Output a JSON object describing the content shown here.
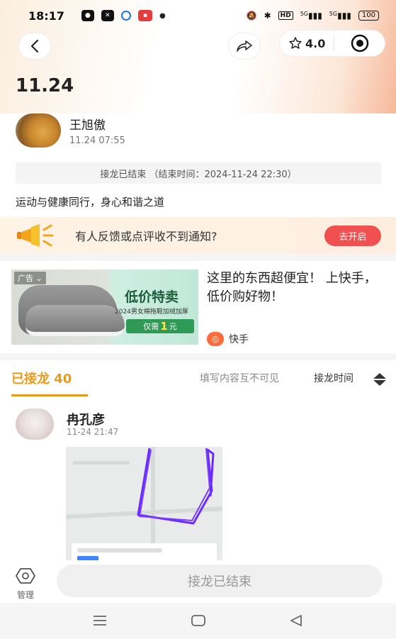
{
  "status_bar": {
    "time": "18:17",
    "battery": "100",
    "network_1": "5G",
    "network_2": "5G",
    "hd": "HD"
  },
  "header": {
    "rating": "4.0"
  },
  "post": {
    "title": "11.24",
    "author_name": "王旭傲",
    "author_time": "11.24 07:55",
    "end_notice": "接龙已结束 （结束时间：2024-11-24 22:30）",
    "description": "运动与健康同行，身心和谐之道"
  },
  "notice": {
    "text": "有人反馈或点评收不到通知?",
    "button": "去开启"
  },
  "ad": {
    "tag": "广告",
    "image_headline": "低价特卖",
    "image_sub": "2024男女棉拖鞋加绒加厚",
    "image_price_prefix": "仅需",
    "image_price_value": "1",
    "image_price_unit": "元",
    "copy": "这里的东西超便宜！ 上快手，低价购好物！",
    "brand": "快手"
  },
  "tabs": {
    "joined_label": "已接龙",
    "joined_count": "40",
    "hint": "填写内容互不可见",
    "sort": "接龙时间"
  },
  "entry": {
    "name": "冉孔彦",
    "time": "11-24 21:47"
  },
  "bottom": {
    "manage_label": "管理",
    "end_button": "接龙已结束"
  },
  "colors": {
    "accent": "#e89a1a",
    "notice_button": "#f05050",
    "route": "#6a2cff"
  }
}
